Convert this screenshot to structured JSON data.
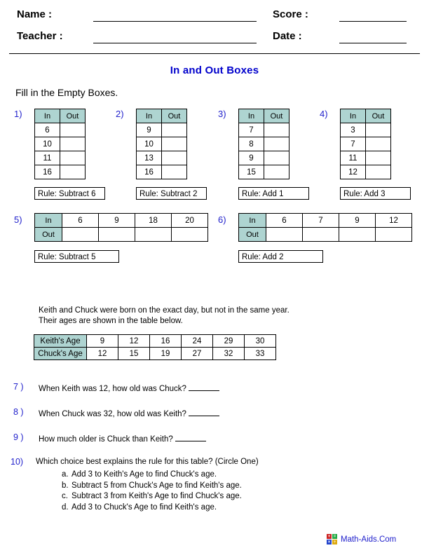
{
  "header": {
    "name_label": "Name :",
    "teacher_label": "Teacher :",
    "score_label": "Score :",
    "date_label": "Date :"
  },
  "title": "In and Out Boxes",
  "instructions": "Fill in the Empty Boxes.",
  "colors": {
    "title_blue": "#0000cc",
    "number_blue": "#2222cc",
    "table_header_teal": "#aed4d1",
    "border_black": "#000000"
  },
  "vertical_problems": [
    {
      "number": "1)",
      "headers": [
        "In",
        "Out"
      ],
      "in_values": [
        "6",
        "10",
        "11",
        "16"
      ],
      "out_values": [
        "",
        "",
        "",
        ""
      ],
      "rule": "Rule: Subtract 6"
    },
    {
      "number": "2)",
      "headers": [
        "In",
        "Out"
      ],
      "in_values": [
        "9",
        "10",
        "13",
        "16"
      ],
      "out_values": [
        "",
        "",
        "",
        ""
      ],
      "rule": "Rule: Subtract 2"
    },
    {
      "number": "3)",
      "headers": [
        "In",
        "Out"
      ],
      "in_values": [
        "7",
        "8",
        "9",
        "15"
      ],
      "out_values": [
        "",
        "",
        "",
        ""
      ],
      "rule": "Rule: Add 1"
    },
    {
      "number": "4)",
      "headers": [
        "In",
        "Out"
      ],
      "in_values": [
        "3",
        "7",
        "11",
        "12"
      ],
      "out_values": [
        "",
        "",
        "",
        ""
      ],
      "rule": "Rule: Add 3"
    }
  ],
  "horizontal_problems": [
    {
      "number": "5)",
      "in_label": "In",
      "out_label": "Out",
      "in_values": [
        "6",
        "9",
        "18",
        "20"
      ],
      "out_values": [
        "",
        "",
        "",
        ""
      ],
      "rule": "Rule: Subtract 5"
    },
    {
      "number": "6)",
      "in_label": "In",
      "out_label": "Out",
      "in_values": [
        "6",
        "7",
        "9",
        "12"
      ],
      "out_values": [
        "",
        "",
        "",
        ""
      ],
      "rule": "Rule: Add 2"
    }
  ],
  "word_problem": {
    "line1": "Keith and Chuck were born on the exact day, but not in the same year.",
    "line2": "Their ages are shown in the table below.",
    "table": {
      "row1_label": "Keith's Age",
      "row1_values": [
        "9",
        "12",
        "16",
        "24",
        "29",
        "30"
      ],
      "row2_label": "Chuck's Age",
      "row2_values": [
        "12",
        "15",
        "19",
        "27",
        "32",
        "33"
      ]
    }
  },
  "questions": [
    {
      "number": "7 )",
      "text": "When Keith was 12, how old was Chuck?",
      "has_blank": true
    },
    {
      "number": "8 )",
      "text": "When Chuck was 32, how old was Keith?",
      "has_blank": true
    },
    {
      "number": "9 )",
      "text": "How much older is Chuck than Keith?",
      "has_blank": true
    },
    {
      "number": "10)",
      "text": "Which choice best explains the rule for this table? (Circle One)",
      "has_blank": false
    }
  ],
  "choices": [
    {
      "letter": "a.",
      "text": "Add 3 to Keith's Age to find Chuck's age."
    },
    {
      "letter": "b.",
      "text": "Subtract 5 from Chuck's Age to find Keith's age."
    },
    {
      "letter": "c.",
      "text": "Subtract 3 from Keith's Age to find Chuck's age."
    },
    {
      "letter": "d.",
      "text": "Add 3 to Chuck's Age to find Keith's age."
    }
  ],
  "footer": {
    "text": "Math-Aids.Com",
    "logo_symbols": [
      "+",
      "=",
      "×",
      "÷"
    ]
  }
}
